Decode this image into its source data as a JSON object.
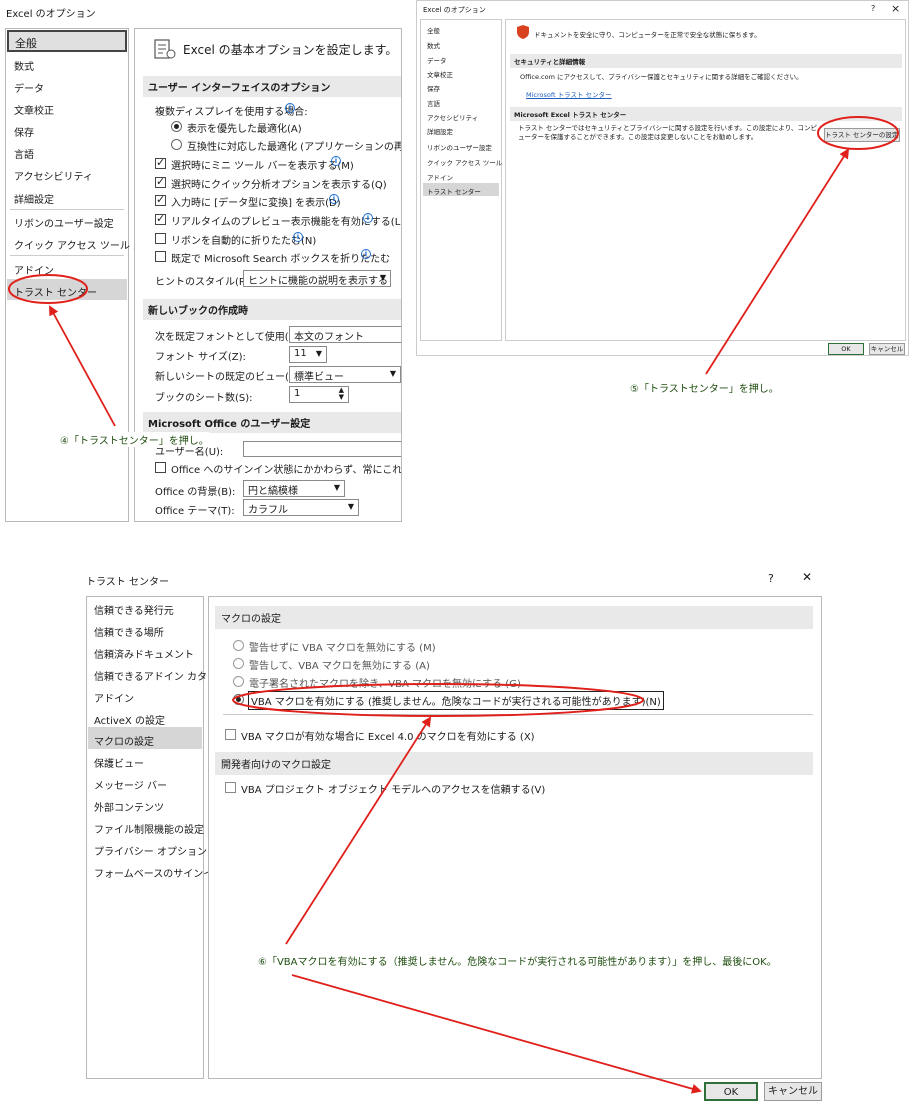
{
  "panel1": {
    "title": "Excel のオプション",
    "nav": [
      "全般",
      "数式",
      "データ",
      "文章校正",
      "保存",
      "言語",
      "アクセシビリティ",
      "詳細設定",
      "リボンのユーザー設定",
      "クイック アクセス ツール バー",
      "アドイン",
      "トラスト センター"
    ],
    "heading": "Excel の基本オプションを設定します。",
    "sec_ui": "ユーザー インターフェイスのオプション",
    "multi_display": "複数ディスプレイを使用する場合:",
    "radio_best": "表示を優先した最適化(A)",
    "radio_compat": "互換性に対応した最適化 (アプリケーションの再起動が必",
    "opt_minibar": "選択時にミニ ツール バーを表示する(M)",
    "opt_quick": "選択時にクイック分析オプションを表示する(Q)",
    "opt_convert": "入力時に [データ型に変換] を表示(D)",
    "opt_preview": "リアルタイムのプレビュー表示機能を有効にする(L)",
    "opt_collapse": "リボンを自動的に折りたたむ(N)",
    "opt_search": "既定で Microsoft Search ボックスを折りたたむ",
    "hint_label": "ヒントのスタイル(R):",
    "hint_value": "ヒントに機能の説明を表示する",
    "sec_new": "新しいブックの作成時",
    "font_label": "次を既定フォントとして使用(N):",
    "font_value": "本文のフォント",
    "size_label": "フォント サイズ(Z):",
    "size_value": "11",
    "view_label": "新しいシートの既定のビュー(V):",
    "view_value": "標準ビュー",
    "sheets_label": "ブックのシート数(S):",
    "sheets_value": "1",
    "sec_user": "Microsoft Office のユーザー設定",
    "username_label": "ユーザー名(U):",
    "signin_opt": "Office へのサインイン状態にかかわらず、常にこれらの設定を",
    "bg_label": "Office の背景(B):",
    "bg_value": "円と縞模様",
    "theme_label": "Office テーマ(T):",
    "theme_value": "カラフル",
    "annotation": "④「トラストセンター」を押し。"
  },
  "panel2": {
    "title": "Excel のオプション",
    "help": "?",
    "close": "×",
    "nav": [
      "全般",
      "数式",
      "データ",
      "文章校正",
      "保存",
      "言語",
      "アクセシビリティ",
      "詳細設定",
      "リボンのユーザー設定",
      "クイック アクセス ツール バー",
      "アドイン",
      "トラスト センター"
    ],
    "banner": "ドキュメントを安全に守り、コンピューターを正常で安全な状態に保ちます。",
    "sec_privacy": "セキュリティと詳細情報",
    "privacy_text": "Office.com にアクセスして、プライバシー保護とセキュリティに関する詳細をご確認ください。",
    "privacy_link": "Microsoft トラスト センター",
    "sec_trust": "Microsoft Excel トラスト センター",
    "trust_text": "トラスト センターではセキュリティとプライバシーに関する設定を行います。この設定により、コンピューターを保護することができます。この設定は変更しないことをお勧めします。",
    "trust_button": "トラスト センターの設定(T)...",
    "ok": "OK",
    "cancel": "キャンセル",
    "annotation": "⑤「トラストセンター」を押し。"
  },
  "panel3": {
    "title": "トラスト センター",
    "help": "?",
    "close": "✕",
    "nav": [
      "信頼できる発行元",
      "信頼できる場所",
      "信頼済みドキュメント",
      "信頼できるアドイン カタログ",
      "アドイン",
      "ActiveX の設定",
      "マクロの設定",
      "保護ビュー",
      "メッセージ バー",
      "外部コンテンツ",
      "ファイル制限機能の設定",
      "プライバシー オプション",
      "フォームベースのサインイン"
    ],
    "sec_macro": "マクロの設定",
    "r1": "警告せずに VBA マクロを無効にする (M)",
    "r2": "警告して、VBA マクロを無効にする (A)",
    "r3": "電子署名されたマクロを除き、VBA マクロを無効にする (G)",
    "r4": "VBA マクロを有効にする (推奨しません。危険なコードが実行される可能性があります)(N)",
    "c1": "VBA マクロが有効な場合に Excel 4.0 のマクロを有効にする (X)",
    "sec_dev": "開発者向けのマクロ設定",
    "c2": "VBA プロジェクト オブジェクト モデルへのアクセスを信頼する(V)",
    "annotation": "⑥「VBAマクロを有効にする（推奨しません。危険なコードが実行される可能性があります）」を押し、最後にOK。",
    "ok": "OK",
    "cancel": "キャンセル"
  },
  "colors": {
    "annotation_red": "#e0201b",
    "annotation_text": "#1f4e10",
    "section_bg": "#e9e9e9",
    "selected_nav": "#d6d6d6",
    "ok_border": "#2f6f3a"
  },
  "icons": [
    "options-settings-icon",
    "info-icon",
    "shield-icon",
    "dropdown-arrow-icon",
    "spinner-icon"
  ]
}
